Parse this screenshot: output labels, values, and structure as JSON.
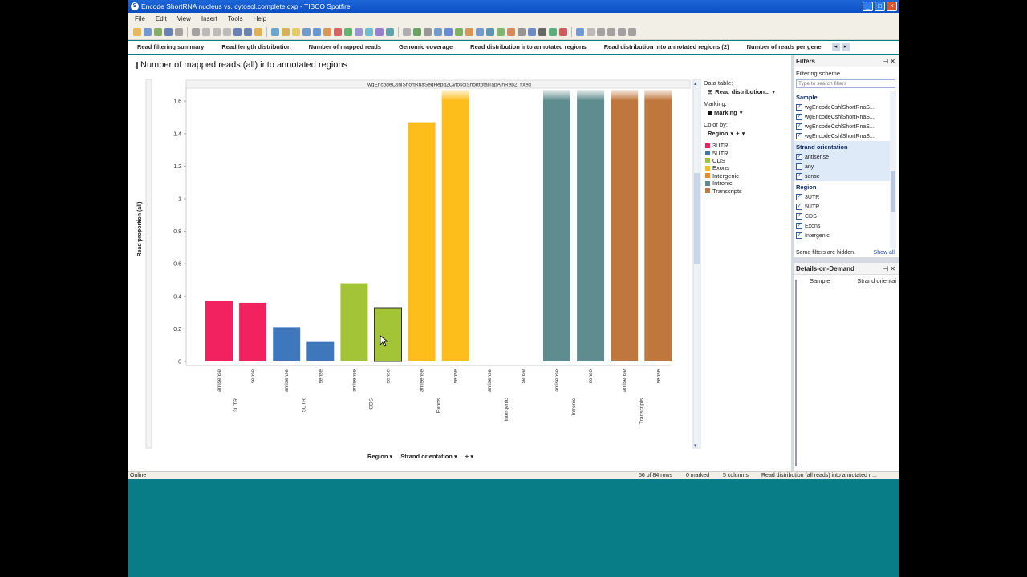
{
  "window": {
    "title": "Encode ShortRNA nucleus vs. cytosol.complete.dxp - TIBCO Spotfire"
  },
  "menu": [
    "File",
    "Edit",
    "View",
    "Insert",
    "Tools",
    "Help"
  ],
  "tabs": [
    "Read filtering summary",
    "Read length distribution",
    "Number of mapped reads",
    "Genomic coverage",
    "Read distribution into annotated regions",
    "Read distribution into annotated regions (2)",
    "Number of reads per gene"
  ],
  "viz": {
    "title": "Number of mapped reads (all) into annotated regions",
    "panel_title": "wgEncodeCshlShortRnaSeqHepg2CytosolShorttotalTapAlnRep2_fixed"
  },
  "legend_panel": {
    "data_table_label": "Data table:",
    "data_table_value": "Read distribution...",
    "marking_label": "Marking:",
    "marking_value": "Marking",
    "color_by_label": "Color by:",
    "color_by_value": "Region"
  },
  "axis_selectors": {
    "x1": "Region",
    "x2": "Strand orientation"
  },
  "chart_data": {
    "type": "bar",
    "title": "",
    "ylabel": "Read proportion (all)",
    "xlabel": "",
    "ylim": [
      0,
      1.7
    ],
    "yticks": [
      0,
      0.2,
      0.4,
      0.6,
      0.8,
      1,
      1.2,
      1.4,
      1.6
    ],
    "grid": false,
    "legend_position": "right",
    "groups": [
      "3UTR",
      "5UTR",
      "CDS",
      "Exons",
      "Intergenic",
      "Intronic",
      "Transcripts"
    ],
    "subcategories": [
      "antisense",
      "sense"
    ],
    "colors": {
      "3UTR": "#f2215f",
      "5UTR": "#3f77bd",
      "CDS": "#a3c437",
      "Exons": "#fdbd1a",
      "Intergenic": "#f28a22",
      "Intronic": "#5f8c8e",
      "Transcripts": "#c0773d"
    },
    "values": [
      {
        "group": "3UTR",
        "sub": "antisense",
        "value": 0.37
      },
      {
        "group": "3UTR",
        "sub": "sense",
        "value": 0.36
      },
      {
        "group": "5UTR",
        "sub": "antisense",
        "value": 0.21
      },
      {
        "group": "5UTR",
        "sub": "sense",
        "value": 0.12
      },
      {
        "group": "CDS",
        "sub": "antisense",
        "value": 0.48
      },
      {
        "group": "CDS",
        "sub": "sense",
        "value": 0.33,
        "marked": true
      },
      {
        "group": "Exons",
        "sub": "antisense",
        "value": 1.47
      },
      {
        "group": "Exons",
        "sub": "sense",
        "value": 1.7,
        "clipped": true
      },
      {
        "group": "Intergenic",
        "sub": "antisense",
        "value": 0
      },
      {
        "group": "Intergenic",
        "sub": "sense",
        "value": 0
      },
      {
        "group": "Intronic",
        "sub": "antisense",
        "value": 1.7,
        "clipped": true
      },
      {
        "group": "Intronic",
        "sub": "sense",
        "value": 1.7,
        "clipped": true
      },
      {
        "group": "Transcripts",
        "sub": "antisense",
        "value": 1.7,
        "clipped": true
      },
      {
        "group": "Transcripts",
        "sub": "sense",
        "value": 1.7,
        "clipped": true
      }
    ]
  },
  "legend_items": [
    "3UTR",
    "5UTR",
    "CDS",
    "Exons",
    "Intergenic",
    "Intronic",
    "Transcripts"
  ],
  "filters": {
    "title": "Filters",
    "scheme": "Filtering scheme",
    "search_placeholder": "Type to search filters",
    "groups": [
      {
        "title": "Sample",
        "highlight": false,
        "items": [
          {
            "label": "wgEncodeCshlShortRnaS...",
            "checked": true
          },
          {
            "label": "wgEncodeCshlShortRnaS...",
            "checked": true
          },
          {
            "label": "wgEncodeCshlShortRnaS...",
            "checked": true
          },
          {
            "label": "wgEncodeCshlShortRnaS...",
            "checked": true
          }
        ]
      },
      {
        "title": "Strand orientation",
        "highlight": true,
        "items": [
          {
            "label": "antisense",
            "checked": true
          },
          {
            "label": "any",
            "checked": false
          },
          {
            "label": "sense",
            "checked": true
          }
        ]
      },
      {
        "title": "Region",
        "highlight": false,
        "items": [
          {
            "label": "3UTR",
            "checked": true
          },
          {
            "label": "5UTR",
            "checked": true
          },
          {
            "label": "CDS",
            "checked": true
          },
          {
            "label": "Exons",
            "checked": true
          },
          {
            "label": "Intergenic",
            "checked": true
          }
        ]
      }
    ],
    "hidden_note": "Some filters are hidden.",
    "show_all": "Show all"
  },
  "details": {
    "title": "Details-on-Demand",
    "col1": "Sample",
    "col2": "Strand orientai"
  },
  "status": {
    "state": "Online",
    "rows": "56 of 84 rows",
    "marked": "0 marked",
    "columns": "5 columns",
    "table": "Read distribution (all reads) into annotated r ..."
  }
}
